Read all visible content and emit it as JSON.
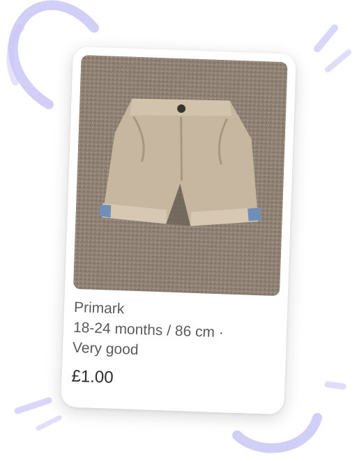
{
  "listing": {
    "image": {
      "alt_subject": "beige shorts",
      "colors": {
        "carpet": "#8e8174",
        "garment": "#c7b7a1",
        "garment_shadow": "#a8977f",
        "cuff_lining": "#6f8fb8"
      }
    },
    "brand": "Primark",
    "size": "18-24 months / 86 cm ·",
    "condition": "Very good",
    "price": "£1.00"
  },
  "decoration": {
    "accent_color": "#c9c6f7"
  }
}
